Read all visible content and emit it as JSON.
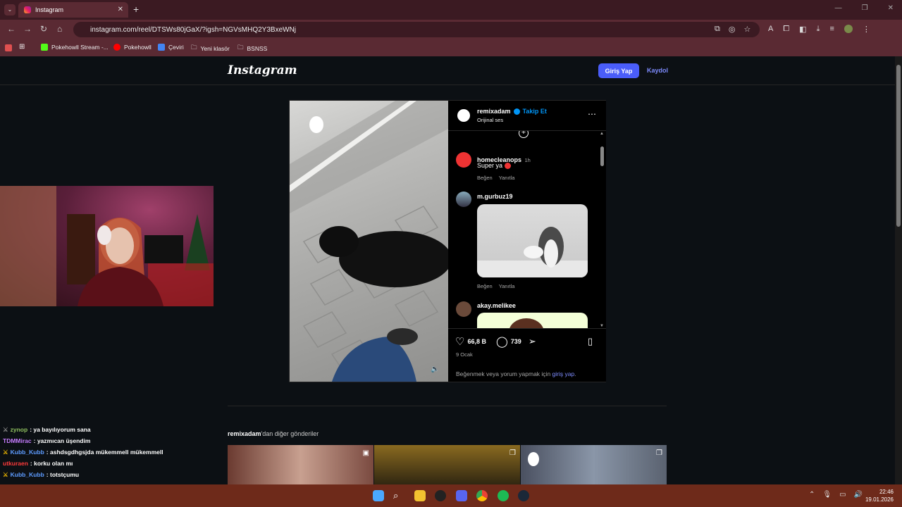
{
  "browser": {
    "tab_title": "Instagram",
    "new_tab": "+",
    "url": "instagram.com/reel/DTSWs80jGaX/?igsh=NGVsMHQ2Y3BxeWNj",
    "bookmarks": [
      "Pokehowll Stream -...",
      "Pokehowll",
      "Çeviri",
      "Yeni klasör",
      "BSNSS"
    ]
  },
  "header": {
    "logo": "Instagram",
    "login": "Giriş Yap",
    "signup": "Kaydol"
  },
  "post": {
    "username": "remixadam",
    "follow": "Takip Et",
    "audio": "Orijinal ses",
    "likes": "66,8 B",
    "comments_count": "739",
    "date": "9 Ocak",
    "login_prompt": "Beğenmek veya yorum yapmak için ",
    "login_link": "giriş yap",
    "login_suffix": ".",
    "comments": [
      {
        "user": "homecleanops",
        "time": "1h",
        "text": "Super ya",
        "like": "Beğen",
        "reply": "Yanıtla"
      },
      {
        "user": "m.gurbuz19",
        "like": "Beğen",
        "reply": "Yanıtla"
      },
      {
        "user": "akay.melikee"
      }
    ]
  },
  "more": {
    "user": "remixadam",
    "suffix": "'dan diğer gönderiler"
  },
  "chat": [
    {
      "user": "zynop",
      "msg": ": ya bayılıyorum sana",
      "color": "#8fbf5f"
    },
    {
      "user": "TDMMirac",
      "msg": ": yazmıcan üşendim",
      "color": "#c77dff"
    },
    {
      "user": "Kubb_Kubb",
      "msg": ": ashdsgdhgsjda mükemmell mükemmell",
      "color": "#5e9cff"
    },
    {
      "user": "utkuraen",
      "msg": ": korku olan mı",
      "color": "#ff3b3b"
    },
    {
      "user": "Kubb_Kubb",
      "msg": ": totstçumu",
      "color": "#5e9cff"
    }
  ],
  "clock": {
    "time": "22:46",
    "date": "19.01.2026"
  }
}
